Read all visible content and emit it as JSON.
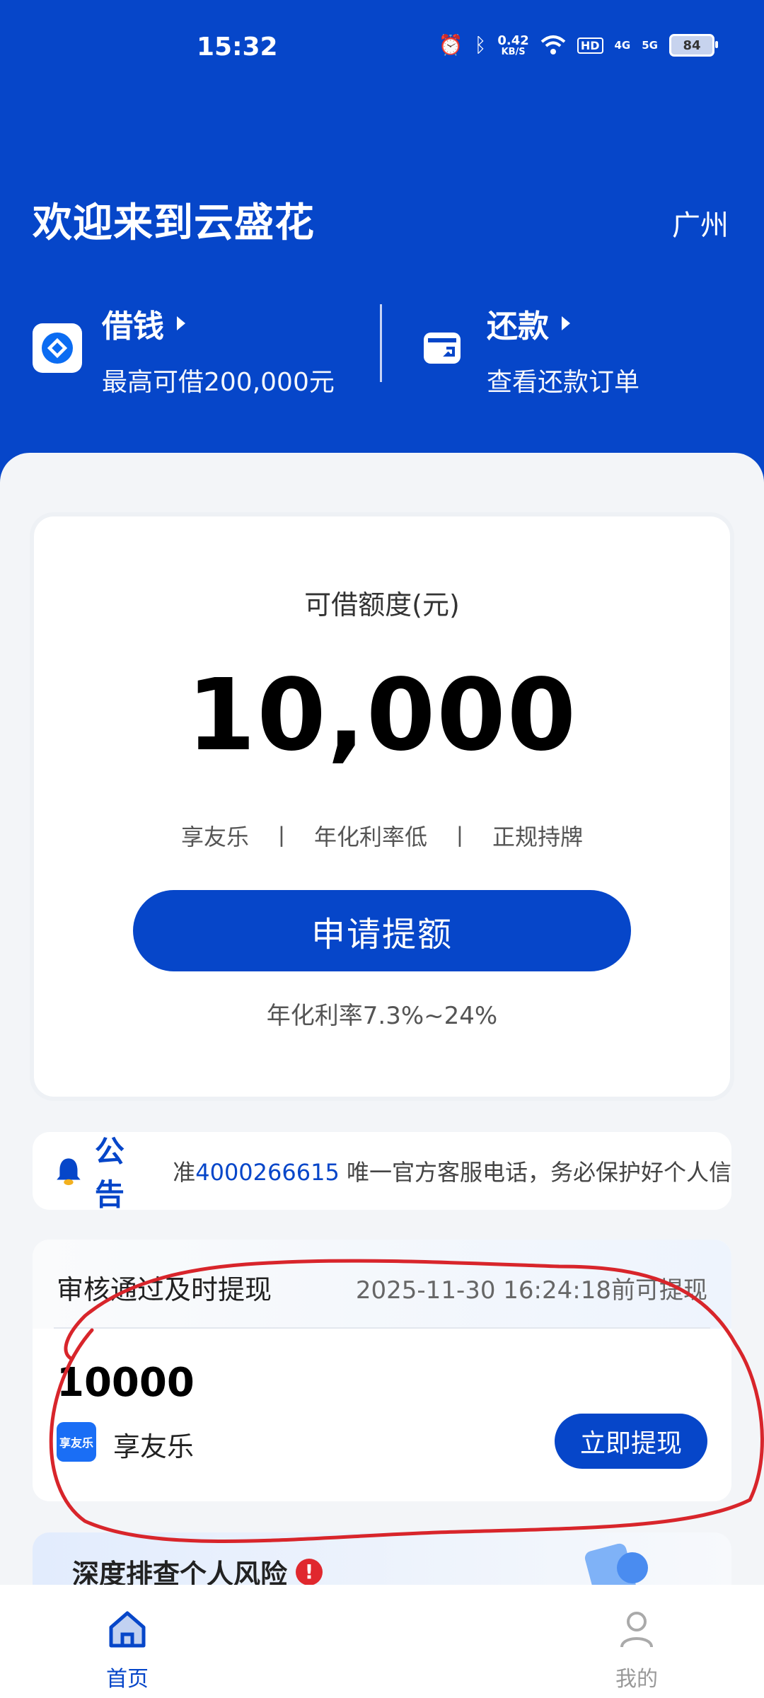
{
  "status_bar": {
    "time": "15:32",
    "speed_value": "0.42",
    "speed_unit": "KB/S",
    "battery": "84",
    "net1": "4G",
    "net2": "5G",
    "hd": "HD"
  },
  "header": {
    "welcome": "欢迎来到云盛花",
    "city": "广州"
  },
  "quick_actions": {
    "borrow_title": "借钱",
    "borrow_sub": "最高可借200,000元",
    "repay_title": "还款",
    "repay_sub": "查看还款订单"
  },
  "quota": {
    "label": "可借额度(元)",
    "amount": "10,000",
    "tags": [
      "享友乐",
      "年化利率低",
      "正规持牌"
    ],
    "separator": "丨",
    "apply_label": "申请提额",
    "rate": "年化利率7.3%~24%"
  },
  "notice": {
    "title": "公告",
    "prefix": "准",
    "phone": "4000266615",
    "text": " 唯一官方客服电话，务必保护好个人信"
  },
  "withdraw": {
    "title": "审核通过及时提现",
    "deadline": "2025-11-30 16:24:18前可提现",
    "amount": "10000",
    "logo_text": "享友乐",
    "name": "享友乐",
    "button": "立即提现"
  },
  "risk": {
    "title": "深度排查个人风险",
    "mark": "!"
  },
  "tabbar": {
    "home": "首页",
    "me": "我的"
  },
  "colors": {
    "primary": "#0646c9",
    "annotation": "#d8252b"
  }
}
